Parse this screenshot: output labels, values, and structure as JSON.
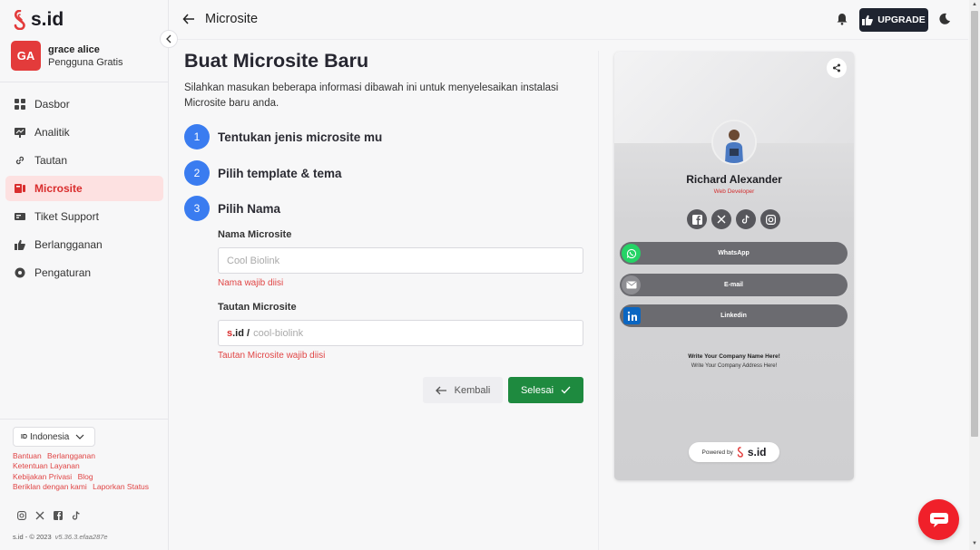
{
  "brand": {
    "name": "s.id",
    "accent": "#e33b3b"
  },
  "user": {
    "initials": "GA",
    "name": "grace alice",
    "plan": "Pengguna Gratis"
  },
  "sidebar": {
    "items": [
      {
        "label": "Dasbor",
        "icon": "dashboard-icon"
      },
      {
        "label": "Analitik",
        "icon": "analytics-icon"
      },
      {
        "label": "Tautan",
        "icon": "link-icon"
      },
      {
        "label": "Microsite",
        "icon": "microsite-icon",
        "active": true
      },
      {
        "label": "Tiket Support",
        "icon": "ticket-icon"
      },
      {
        "label": "Berlangganan",
        "icon": "thumbs-up-icon"
      },
      {
        "label": "Pengaturan",
        "icon": "settings-icon"
      }
    ],
    "language": {
      "code": "ID",
      "label": "Indonesia"
    },
    "footer_links": [
      "Bantuan",
      "Berlangganan",
      "Ketentuan Layanan",
      "Kebijakan Privasi",
      "Blog",
      "Beriklan dengan kami",
      "Laporkan Status"
    ],
    "copyright": "s.id - © 2023",
    "version": "v5.36.3.efaa287e"
  },
  "header": {
    "title": "Microsite",
    "upgrade_label": "UPGRADE"
  },
  "form": {
    "title": "Buat Microsite Baru",
    "description": "Silahkan masukan beberapa informasi dibawah ini untuk menyelesaikan instalasi Microsite baru anda.",
    "steps": [
      {
        "num": "1",
        "label": "Tentukan jenis microsite mu"
      },
      {
        "num": "2",
        "label": "Pilih template & tema"
      },
      {
        "num": "3",
        "label": "Pilih Nama"
      }
    ],
    "name_label": "Nama Microsite",
    "name_placeholder": "Cool Biolink",
    "name_error": "Nama wajib diisi",
    "link_label": "Tautan Microsite",
    "link_prefix_s": "s",
    "link_prefix_rest": ".id /",
    "link_placeholder": "cool-biolink",
    "link_error": "Tautan Microsite wajib diisi",
    "back_label": "Kembali",
    "finish_label": "Selesai"
  },
  "preview": {
    "name": "Richard Alexander",
    "role": "Web Developer",
    "links": [
      {
        "label": "WhatsApp",
        "icon": "whatsapp-icon",
        "color": "#25d366"
      },
      {
        "label": "E-mail",
        "icon": "mail-icon",
        "color": "#8d8d92"
      },
      {
        "label": "Linkedin",
        "icon": "linkedin-icon",
        "color": "#0a66c2"
      }
    ],
    "company_name": "Write Your Company Name Here!",
    "company_address": "Write Your Company Address Here!",
    "powered_by": "Powered by",
    "powered_logo": "s.id"
  }
}
